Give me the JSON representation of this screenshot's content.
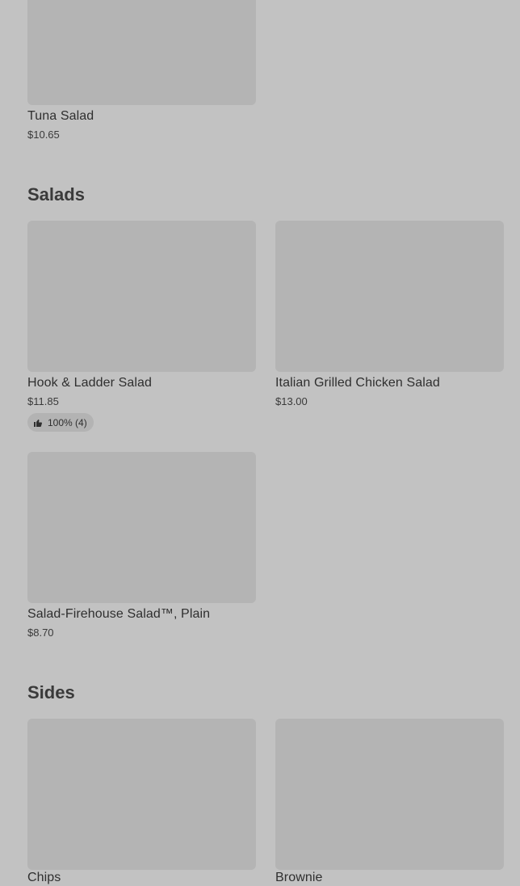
{
  "sections": {
    "top": {
      "items": [
        {
          "name": "Tuna Salad",
          "price": "$10.65"
        }
      ]
    },
    "salads": {
      "title": "Salads",
      "items": [
        {
          "name": "Hook & Ladder Salad",
          "price": "$11.85",
          "rating": "100% (4)"
        },
        {
          "name": "Italian Grilled Chicken Salad",
          "price": "$13.00"
        },
        {
          "name": "Salad-Firehouse Salad™, Plain",
          "price": "$8.70"
        }
      ]
    },
    "sides": {
      "title": "Sides",
      "items": [
        {
          "name": "Chips"
        },
        {
          "name": "Brownie"
        }
      ]
    }
  },
  "icons": {
    "rating": "thumbs-up-icon"
  },
  "colors": {
    "background": "#c2c2c2",
    "placeholder": "#b4b4b4",
    "badge": "#b3b3b3",
    "text": "#2f2f2f"
  }
}
